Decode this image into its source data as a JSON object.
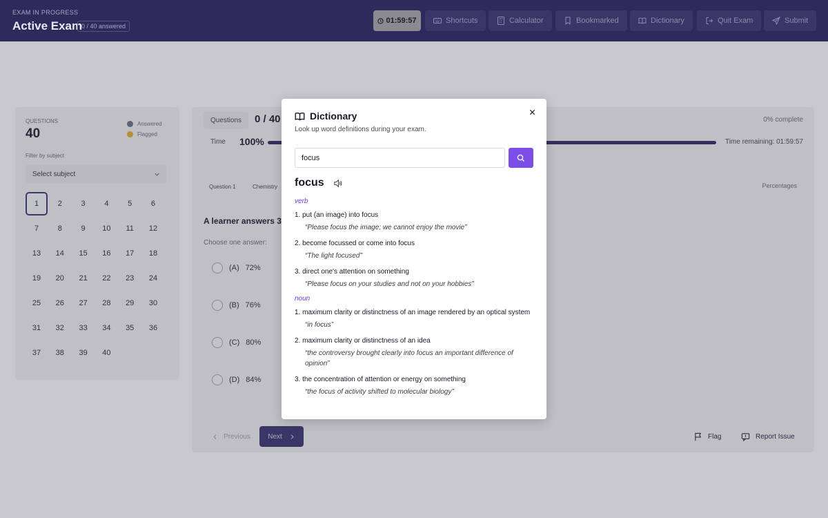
{
  "header": {
    "kicker": "EXAM IN PROGRESS",
    "title": "Active Exam",
    "answered_badge": "0 / 40 answered",
    "timer": "01:59:57",
    "buttons": {
      "shortcuts": "Shortcuts",
      "calculator": "Calculator",
      "bookmarked": "Bookmarked",
      "dictionary": "Dictionary",
      "quit": "Quit Exam",
      "submit": "Submit"
    }
  },
  "sidebar": {
    "kicker": "QUESTIONS",
    "total": "40",
    "legend": {
      "answered": "Answered",
      "flagged": "Flagged"
    },
    "filter_label": "Filter by subject",
    "select_value": "Select subject",
    "questions": [
      "1",
      "2",
      "3",
      "4",
      "5",
      "6",
      "7",
      "8",
      "9",
      "10",
      "11",
      "12",
      "13",
      "14",
      "15",
      "16",
      "17",
      "18",
      "19",
      "20",
      "21",
      "22",
      "23",
      "24",
      "25",
      "26",
      "27",
      "28",
      "29",
      "30",
      "31",
      "32",
      "33",
      "34",
      "35",
      "36",
      "37",
      "38",
      "39",
      "40"
    ],
    "current": "1"
  },
  "main": {
    "questions_label": "Questions",
    "count": "0 / 40",
    "percent_complete": "0% complete",
    "time_label": "Time",
    "time_pct": "100%",
    "time_fraction": 1.0,
    "time_remaining": "Time remaining: 01:59:57",
    "question_tag": "Question 1",
    "subject_tag": "Chemistry",
    "topic_tag": "Percentages",
    "question_text": "A learner answers 36",
    "choose_label": "Choose one answer:",
    "options": [
      {
        "letter": "(A)",
        "value": "72%"
      },
      {
        "letter": "(B)",
        "value": "76%"
      },
      {
        "letter": "(C)",
        "value": "80%"
      },
      {
        "letter": "(D)",
        "value": "84%"
      }
    ],
    "prev_label": "Previous",
    "next_label": "Next",
    "flag_label": "Flag",
    "report_label": "Report Issue"
  },
  "modal": {
    "title": "Dictionary",
    "subtitle": "Look up word definitions during your exam.",
    "search_value": "focus",
    "word": "focus",
    "sections": [
      {
        "pos": "verb",
        "definitions": [
          {
            "text": "1. put (an image) into focus",
            "example": "“Please focus the image; we cannot enjoy the movie”"
          },
          {
            "text": "2. become focussed or come into focus",
            "example": "“The light focused”"
          },
          {
            "text": "3. direct one's attention on something",
            "example": "“Please focus on your studies and not on your hobbies”"
          }
        ]
      },
      {
        "pos": "noun",
        "definitions": [
          {
            "text": "1. maximum clarity or distinctness of an image rendered by an optical system",
            "example": "“in focus”"
          },
          {
            "text": "2. maximum clarity or distinctness of an idea",
            "example": "“the controversy brought clearly into focus an important difference of opinion”"
          },
          {
            "text": "3. the concentration of attention or energy on something",
            "example": "“the focus of activity shifted to molecular biology”"
          }
        ]
      }
    ]
  },
  "colors": {
    "header_bg": "#2e2a5c",
    "accent_purple": "#7d4ee6",
    "answered_dot": "#6f6f86",
    "flagged_dot": "#d6a93a",
    "next_button": "#3d3a74"
  }
}
